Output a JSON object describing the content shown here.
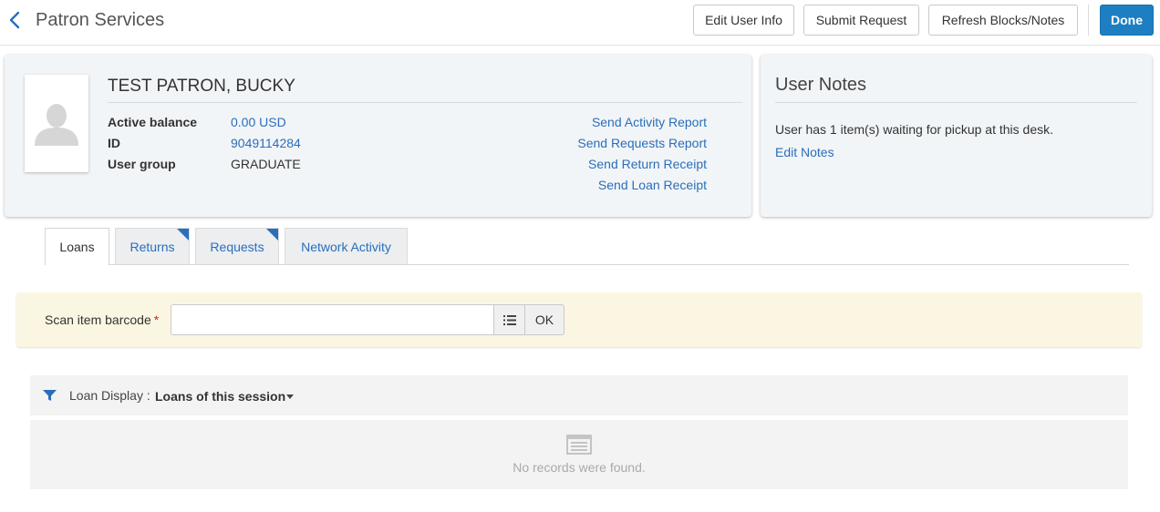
{
  "header": {
    "title": "Patron Services",
    "buttons": {
      "edit_user_info": "Edit User Info",
      "submit_request": "Submit Request",
      "refresh_blocks_notes": "Refresh Blocks/Notes",
      "done": "Done"
    }
  },
  "patron": {
    "name": "TEST PATRON, BUCKY",
    "fields": [
      {
        "label": "Active balance",
        "value": "0.00 USD"
      },
      {
        "label": "ID",
        "value": "9049114284"
      },
      {
        "label": "User group",
        "value": "GRADUATE"
      }
    ],
    "actions": [
      "Send Activity Report",
      "Send Requests Report",
      "Send Return Receipt",
      "Send Loan Receipt"
    ]
  },
  "notes": {
    "title": "User Notes",
    "text": "User has 1 item(s) waiting for pickup at this desk.",
    "edit_label": "Edit Notes"
  },
  "tabs": [
    {
      "label": "Loans",
      "active": true,
      "flagged": false
    },
    {
      "label": "Returns",
      "active": false,
      "flagged": true
    },
    {
      "label": "Requests",
      "active": false,
      "flagged": true
    },
    {
      "label": "Network Activity",
      "active": false,
      "flagged": false
    }
  ],
  "scan": {
    "label": "Scan item barcode",
    "required_marker": "*",
    "value": "",
    "ok_label": "OK"
  },
  "loan_display": {
    "label": "Loan Display :",
    "value": "Loans of this session",
    "empty_text": "No records were found."
  },
  "colors": {
    "accent": "#1d7fc1",
    "link": "#2a6ebb",
    "scan_bg": "#fbf6e2",
    "required": "#c62828"
  },
  "icons": [
    "chevron-left-icon",
    "avatar-placeholder-icon",
    "list-icon",
    "filter-icon",
    "caret-down-icon",
    "empty-list-icon"
  ]
}
